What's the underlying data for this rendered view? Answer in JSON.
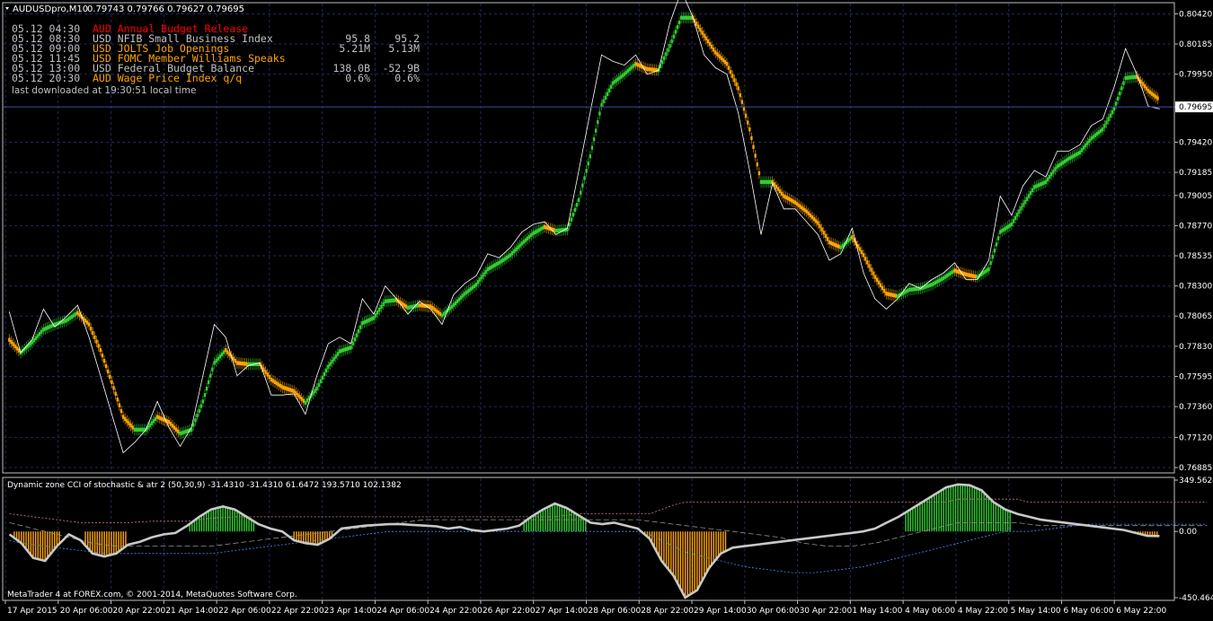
{
  "window": {
    "title_symbol": "AUDUSDpro,M10",
    "title_quotes": "0.79743 0.79766 0.79627 0.79695"
  },
  "news": [
    {
      "time": "05.12 04:30",
      "currency": "AUD",
      "event": "AUD Annual Budget Release",
      "actual": "",
      "forecast": "",
      "color": "#ff0000"
    },
    {
      "time": "05.12 08:30",
      "currency": "USD",
      "event": "USD NFIB Small Business Index",
      "actual": "95.8",
      "forecast": "95.2",
      "color": "#c0c0c0"
    },
    {
      "time": "05.12 09:00",
      "currency": "USD",
      "event": "USD JOLTS Job Openings",
      "actual": "5.21M",
      "forecast": "5.13M",
      "color": "#ffa500"
    },
    {
      "time": "05.12 11:45",
      "currency": "USD",
      "event": "USD FOMC Member Williams Speaks",
      "actual": "",
      "forecast": "",
      "color": "#ffa500"
    },
    {
      "time": "05.12 13:00",
      "currency": "USD",
      "event": "USD Federal Budget Balance",
      "actual": "138.0B",
      "forecast": "-52.9B",
      "color": "#c0c0c0"
    },
    {
      "time": "05.12 20:30",
      "currency": "AUD",
      "event": "AUD Wage Price Index q/q",
      "actual": "0.6%",
      "forecast": "0.6%",
      "color": "#ffa500"
    }
  ],
  "last_download": "last downloaded at 19:30:51 local time",
  "indicator_title": "Dynamic zone CCI of stochastic & atr 2 (50,30,9) -31.4310 -31.4310 61.6472 193.5710 102.1382",
  "copyright": "MetaTrader 4 at FOREX.com, © 2001-2014, MetaQuotes Software Corp.",
  "colors": {
    "background": "#000000",
    "grid": "#1e2a5a",
    "frame": "#c0c0c0",
    "bull": "#32cd32",
    "bear": "#ffa500",
    "close_line": "#ffffff",
    "current_price_line": "#3a4a9a",
    "cci_line": "#c8c8c8"
  },
  "chart_data": [
    {
      "type": "line",
      "title": "AUDUSDpro,M10",
      "ylim": [
        0.7685,
        0.805
      ],
      "y_ticks": [
        "0.80420",
        "0.80185",
        "0.79950",
        "0.79695",
        "0.79420",
        "0.79185",
        "0.79005",
        "0.78770",
        "0.78535",
        "0.78300",
        "0.78065",
        "0.77830",
        "0.77595",
        "0.77360",
        "0.77120",
        "0.76885"
      ],
      "x_ticks": [
        "17 Apr 2015",
        "20 Apr 06:00",
        "20 Apr 22:00",
        "21 Apr 14:00",
        "22 Apr 06:00",
        "22 Apr 22:00",
        "23 Apr 14:00",
        "24 Apr 06:00",
        "24 Apr 22:00",
        "26 Apr 22:00",
        "27 Apr 14:00",
        "28 Apr 06:00",
        "28 Apr 22:00",
        "29 Apr 14:00",
        "30 Apr 06:00",
        "30 Apr 22:00",
        "1 May 14:00",
        "4 May 06:00",
        "4 May 22:00",
        "5 May 14:00",
        "6 May 06:00",
        "6 May 22:00"
      ],
      "current_price": 0.79695,
      "series": [
        {
          "name": "close",
          "values": [
            0.781,
            0.7778,
            0.7788,
            0.7812,
            0.7798,
            0.7806,
            0.7815,
            0.779,
            0.776,
            0.773,
            0.77,
            0.7708,
            0.7718,
            0.774,
            0.772,
            0.7705,
            0.772,
            0.776,
            0.78,
            0.779,
            0.776,
            0.7768,
            0.777,
            0.7745,
            0.7745,
            0.7746,
            0.773,
            0.776,
            0.7785,
            0.779,
            0.7785,
            0.782,
            0.7808,
            0.783,
            0.782,
            0.7808,
            0.7818,
            0.7812,
            0.78,
            0.7823,
            0.7832,
            0.7838,
            0.7855,
            0.7852,
            0.786,
            0.7872,
            0.7878,
            0.788,
            0.787,
            0.7875,
            0.792,
            0.7965,
            0.801,
            0.8005,
            0.8002,
            0.801,
            0.7995,
            0.7998,
            0.8035,
            0.806,
            0.804,
            0.801,
            0.8,
            0.7995,
            0.7965,
            0.792,
            0.787,
            0.791,
            0.789,
            0.789,
            0.788,
            0.787,
            0.785,
            0.7855,
            0.7875,
            0.784,
            0.782,
            0.7812,
            0.782,
            0.7832,
            0.7828,
            0.7835,
            0.784,
            0.7848,
            0.7835,
            0.7835,
            0.785,
            0.79,
            0.7885,
            0.7908,
            0.792,
            0.7915,
            0.7935,
            0.7935,
            0.794,
            0.7955,
            0.796,
            0.7985,
            0.8015,
            0.7995,
            0.797,
            0.7968
          ]
        },
        {
          "name": "heiken-ashi",
          "values": [
            0.7788,
            0.7778,
            0.7786,
            0.7796,
            0.78,
            0.7803,
            0.7809,
            0.78,
            0.778,
            0.7755,
            0.7728,
            0.7718,
            0.7718,
            0.7728,
            0.7724,
            0.7715,
            0.7718,
            0.774,
            0.777,
            0.778,
            0.777,
            0.7769,
            0.7769,
            0.7757,
            0.7751,
            0.7748,
            0.7739,
            0.775,
            0.7767,
            0.7779,
            0.7782,
            0.7801,
            0.7805,
            0.7818,
            0.7819,
            0.7813,
            0.7815,
            0.7814,
            0.7807,
            0.7815,
            0.7824,
            0.7831,
            0.7843,
            0.7848,
            0.7854,
            0.7863,
            0.7871,
            0.7876,
            0.7873,
            0.7874,
            0.7897,
            0.7931,
            0.7971,
            0.7988,
            0.7995,
            0.8003,
            0.7999,
            0.7998,
            0.8017,
            0.8039,
            0.8039,
            0.8025,
            0.8012,
            0.8003,
            0.7984,
            0.7952,
            0.7911,
            0.7911,
            0.79,
            0.7895,
            0.7888,
            0.7879,
            0.7864,
            0.786,
            0.7868,
            0.7854,
            0.7837,
            0.7824,
            0.7822,
            0.7827,
            0.7828,
            0.7831,
            0.7836,
            0.7842,
            0.7839,
            0.7837,
            0.7843,
            0.7872,
            0.7878,
            0.7893,
            0.7907,
            0.7911,
            0.7923,
            0.7929,
            0.7934,
            0.7945,
            0.7952,
            0.7968,
            0.7992,
            0.7993,
            0.7982,
            0.7975
          ]
        }
      ]
    },
    {
      "type": "line",
      "title": "Dynamic zone CCI of stochastic & atr 2 (50,30,9)",
      "ylim": [
        -450.4648,
        349.5624
      ],
      "y_ticks": [
        "349.5624",
        "0.00",
        "-450.4648"
      ],
      "series": [
        {
          "name": "cci",
          "values": [
            -20,
            -80,
            -180,
            -200,
            -100,
            -20,
            -60,
            -150,
            -170,
            -150,
            -90,
            -70,
            -40,
            -20,
            -10,
            40,
            100,
            150,
            170,
            150,
            100,
            50,
            20,
            0,
            -60,
            -80,
            -90,
            -50,
            20,
            30,
            40,
            45,
            50,
            50,
            45,
            40,
            35,
            20,
            30,
            10,
            0,
            10,
            20,
            40,
            100,
            150,
            190,
            160,
            110,
            60,
            50,
            60,
            40,
            20,
            -50,
            -200,
            -300,
            -450,
            -400,
            -250,
            -150,
            -110,
            -100,
            -90,
            -80,
            -70,
            -60,
            -50,
            -40,
            -30,
            -20,
            -10,
            0,
            20,
            60,
            100,
            150,
            200,
            250,
            300,
            320,
            315,
            280,
            200,
            150,
            120,
            100,
            80,
            70,
            60,
            50,
            40,
            30,
            20,
            10,
            -10,
            -30,
            -31
          ]
        },
        {
          "name": "upper-zone",
          "values": [
            120,
            110,
            100,
            90,
            80,
            70,
            60,
            60,
            60,
            60,
            60,
            65,
            70,
            70,
            70,
            70,
            80,
            90,
            95,
            100,
            100,
            100,
            100,
            100,
            100,
            100,
            100,
            100,
            100,
            100,
            100,
            100,
            100,
            100,
            100,
            100,
            100,
            100,
            100,
            100,
            100,
            100,
            100,
            100,
            100,
            100,
            100,
            110,
            120,
            120,
            120,
            120,
            120,
            120,
            120,
            150,
            180,
            200,
            200,
            200,
            200,
            200,
            200,
            200,
            200,
            200,
            200,
            200,
            200,
            200,
            200,
            200,
            200,
            200,
            200,
            200,
            200,
            200,
            200,
            200,
            220,
            220,
            220,
            220,
            220,
            220,
            200,
            200,
            200,
            200,
            200,
            200,
            200,
            200,
            200,
            200,
            200,
            200,
            200,
            200,
            200,
            200
          ]
        },
        {
          "name": "mid-zone",
          "values": [
            60,
            40,
            20,
            0,
            -20,
            -40,
            -60,
            -80,
            -90,
            -100,
            -100,
            -100,
            -100,
            -100,
            -100,
            -100,
            -100,
            -100,
            -90,
            -80,
            -70,
            -60,
            -50,
            -40,
            -30,
            -20,
            -10,
            0,
            10,
            20,
            30,
            40,
            50,
            60,
            70,
            80,
            80,
            80,
            80,
            80,
            80,
            80,
            80,
            80,
            80,
            80,
            80,
            80,
            80,
            80,
            80,
            80,
            80,
            80,
            70,
            60,
            50,
            40,
            30,
            20,
            10,
            0,
            -10,
            -20,
            -30,
            -40,
            -60,
            -80,
            -90,
            -100,
            -100,
            -100,
            -90,
            -80,
            -60,
            -40,
            -20,
            0,
            20,
            40,
            60,
            60,
            60,
            60,
            60,
            60,
            50,
            40,
            40,
            40,
            40,
            40,
            40,
            40,
            40,
            40,
            40,
            40,
            40,
            40,
            40,
            40
          ]
        },
        {
          "name": "lower-zone",
          "values": [
            -60,
            -80,
            -90,
            -100,
            -110,
            -120,
            -130,
            -140,
            -150,
            -150,
            -150,
            -150,
            -150,
            -150,
            -150,
            -150,
            -150,
            -150,
            -140,
            -130,
            -120,
            -110,
            -100,
            -90,
            -80,
            -70,
            -60,
            -50,
            -40,
            -30,
            -20,
            -10,
            0,
            0,
            0,
            0,
            0,
            0,
            0,
            0,
            0,
            0,
            0,
            0,
            0,
            0,
            0,
            0,
            0,
            0,
            0,
            0,
            0,
            0,
            -20,
            -60,
            -100,
            -140,
            -160,
            -180,
            -200,
            -220,
            -240,
            -250,
            -260,
            -270,
            -280,
            -280,
            -280,
            -270,
            -260,
            -250,
            -240,
            -220,
            -200,
            -180,
            -160,
            -140,
            -120,
            -100,
            -80,
            -60,
            -40,
            -20,
            0,
            0,
            0,
            10,
            20,
            30,
            40,
            50,
            50,
            50,
            50,
            50,
            50,
            50,
            50,
            50,
            50,
            50
          ]
        }
      ]
    }
  ]
}
